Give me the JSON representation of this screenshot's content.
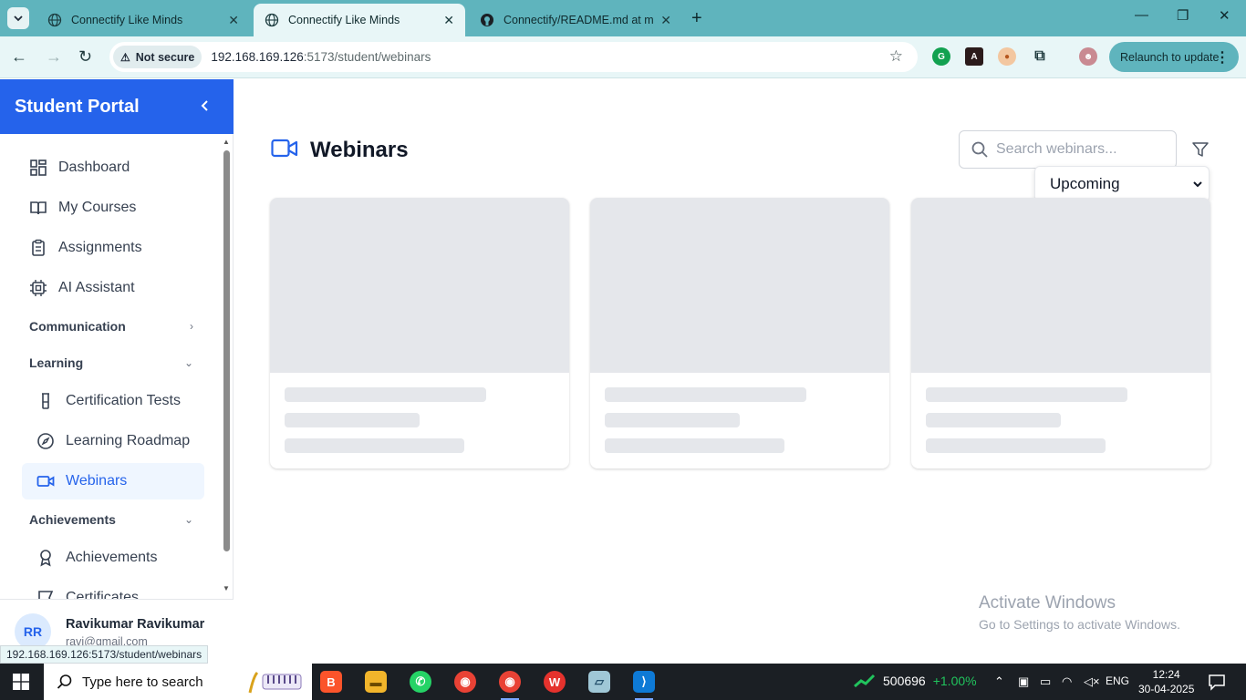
{
  "browser": {
    "tabs": [
      {
        "title": "Connectify Like Minds",
        "active": false
      },
      {
        "title": "Connectify Like Minds",
        "active": true
      },
      {
        "title": "Connectify/README.md at mai",
        "active": false
      }
    ],
    "security_label": "Not secure",
    "url_host": "192.168.169.126",
    "url_rest": ":5173/student/webinars",
    "relaunch_label": "Relaunch to update",
    "status_url": "192.168.169.126:5173/student/webinars"
  },
  "sidebar": {
    "title": "Student Portal",
    "items": [
      {
        "label": "Dashboard",
        "icon": "dashboard-icon"
      },
      {
        "label": "My Courses",
        "icon": "book-icon"
      },
      {
        "label": "Assignments",
        "icon": "clipboard-icon"
      },
      {
        "label": "AI Assistant",
        "icon": "cpu-icon"
      }
    ],
    "sections": {
      "communication": "Communication",
      "learning": "Learning",
      "achievements": "Achievements"
    },
    "learning_items": [
      {
        "label": "Certification Tests",
        "icon": "flask-icon"
      },
      {
        "label": "Learning Roadmap",
        "icon": "compass-icon"
      },
      {
        "label": "Webinars",
        "icon": "video-icon",
        "active": true
      }
    ],
    "achievement_items": [
      {
        "label": "Achievements",
        "icon": "award-icon"
      },
      {
        "label": "Certificates",
        "icon": "certificate-icon"
      }
    ],
    "user": {
      "initials": "RR",
      "name": "Ravikumar Ravikumar",
      "email": "ravi@gmail.com"
    }
  },
  "main": {
    "title": "Webinars",
    "search_placeholder": "Search webinars...",
    "filter_value": "Upcoming",
    "cards_loading": 3
  },
  "watermark": {
    "line1": "Activate Windows",
    "line2": "Go to Settings to activate Windows."
  },
  "taskbar": {
    "search_placeholder": "Type here to search",
    "stock_value": "500696",
    "stock_change": "+1.00%",
    "language": "ENG",
    "time": "12:24",
    "date": "30-04-2025"
  },
  "colors": {
    "accent": "#2563eb",
    "chrome": "#5fb4bd",
    "skeleton": "#e5e7eb"
  }
}
